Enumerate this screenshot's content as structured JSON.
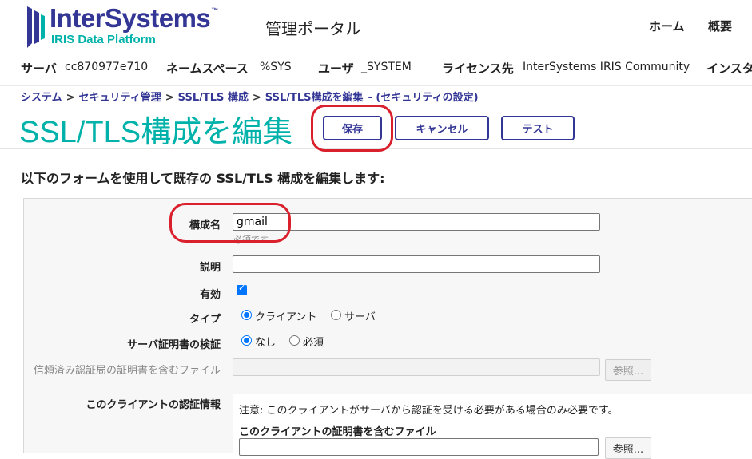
{
  "header": {
    "logo_main": "InterSystems",
    "logo_tm": "™",
    "logo_sub": "IRIS Data Platform",
    "portal_title": "管理ポータル",
    "links": {
      "home": "ホーム",
      "overview": "概要"
    }
  },
  "info_bar": {
    "server_label": "サーバ",
    "server_value": "cc870977e710",
    "namespace_label": "ネームスペース",
    "namespace_value": "%SYS",
    "user_label": "ユーザ",
    "user_value": "_SYSTEM",
    "license_label": "ライセンス先",
    "license_value": "InterSystems IRIS Community",
    "instance_label": "インスタ"
  },
  "breadcrumb": {
    "items": [
      "システム",
      "セキュリティ管理",
      "SSL/TLS 構成",
      "SSL/TLS構成を編集"
    ],
    "separator": ">",
    "note": "- (セキュリティの設定)"
  },
  "page": {
    "title": "SSL/TLS構成を編集",
    "buttons": {
      "save": "保存",
      "cancel": "キャンセル",
      "test": "テスト"
    },
    "description": "以下のフォームを使用して既存の SSL/TLS 構成を編集します:"
  },
  "form": {
    "config_name_label": "構成名",
    "config_name_value": "gmail",
    "required_hint": "必須です。",
    "description_label": "説明",
    "description_value": "",
    "enabled_label": "有効",
    "enabled_checked": true,
    "type_label": "タイプ",
    "type_options": [
      "クライアント",
      "サーバ"
    ],
    "type_selected": "クライアント",
    "verify_label": "サーバ証明書の検証",
    "verify_options": [
      "なし",
      "必須"
    ],
    "verify_selected": "なし",
    "ca_file_label": "信頼済み認証局の証明書を含むファイル",
    "browse_label": "参照...",
    "client_cred_label": "このクライアントの認証情報",
    "client_cred_note": "注意: このクライアントがサーバから認証を受ける必要がある場合のみ必要です。",
    "client_cert_label": "このクライアントの証明書を含むファイル"
  },
  "colors": {
    "brand_navy": "#333695",
    "brand_teal": "#00b2a9",
    "annotation_red": "#d9202c",
    "checkbox_blue": "#0075ff"
  }
}
